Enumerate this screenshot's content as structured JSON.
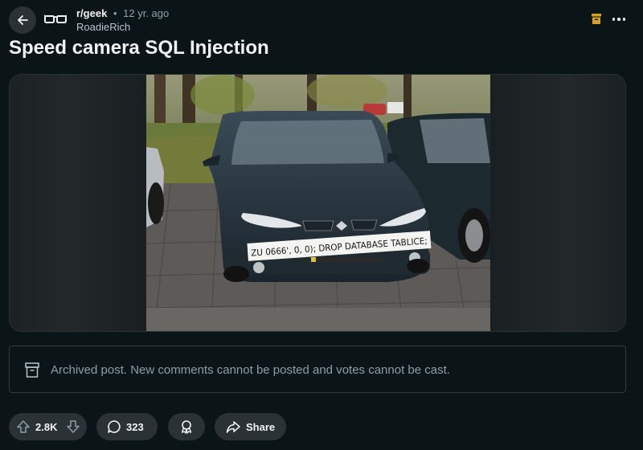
{
  "header": {
    "subreddit": "r/geek",
    "separator": "•",
    "age": "12 yr. ago",
    "author": "RoadieRich"
  },
  "post": {
    "title": "Speed camera SQL Injection",
    "image": {
      "plate_text": "ZU 0666', 0, 0); DROP DATABASE TABLICE;"
    },
    "archived_notice": "Archived post. New comments cannot be posted and votes cannot be cast."
  },
  "actions": {
    "score": "2.8K",
    "comments": "323",
    "share_label": "Share"
  },
  "colors": {
    "background": "#0b1416",
    "pill": "#2a3236",
    "archive_badge": "#d9a120"
  },
  "icons": {
    "back": "arrow-left-icon",
    "subreddit_avatar": "glasses-icon",
    "archive": "archive-box-icon",
    "more": "more-horizontal-icon",
    "upvote": "upvote-arrow-icon",
    "downvote": "downvote-arrow-icon",
    "comment": "speech-bubble-icon",
    "award": "award-ribbon-icon",
    "share": "share-arrow-icon"
  }
}
